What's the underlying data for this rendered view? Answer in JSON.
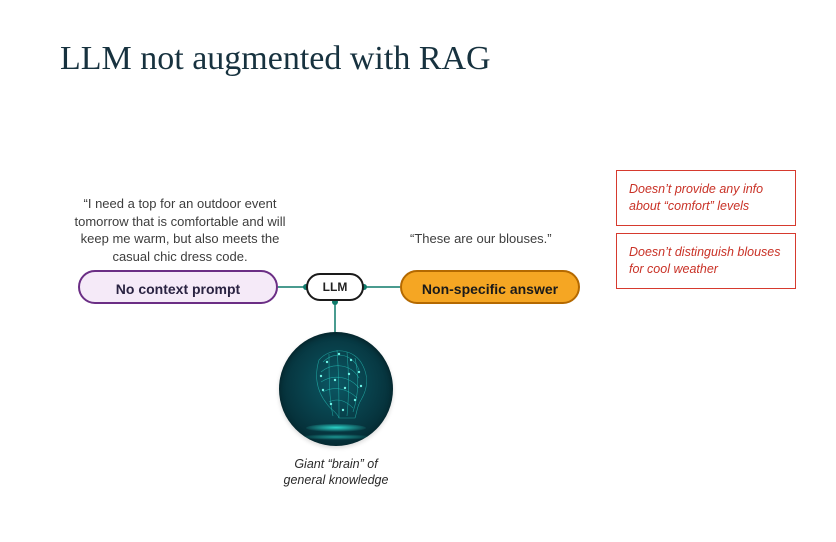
{
  "title": "LLM not augmented with RAG",
  "prompt_quote": "“I need a top for an outdoor event tomorrow that is comfortable and will keep me warm, but also meets the casual chic dress code.",
  "answer_quote": "“These are our blouses.”",
  "pill_left": "No context prompt",
  "pill_llm": "LLM",
  "pill_right": "Non-specific answer",
  "callout_1": "Doesn’t provide any info about “comfort” levels",
  "callout_2": "Doesn’t distinguish blouses for cool weather",
  "brain_caption": "Giant “brain” of general knowledge",
  "colors": {
    "title": "#17323f",
    "left_pill_bg": "#f5eaf8",
    "left_pill_border": "#6b2e85",
    "right_pill_bg": "#f5a623",
    "right_pill_border": "#b46900",
    "callout_border": "#d63a2e",
    "connector": "#0e7a6a"
  }
}
